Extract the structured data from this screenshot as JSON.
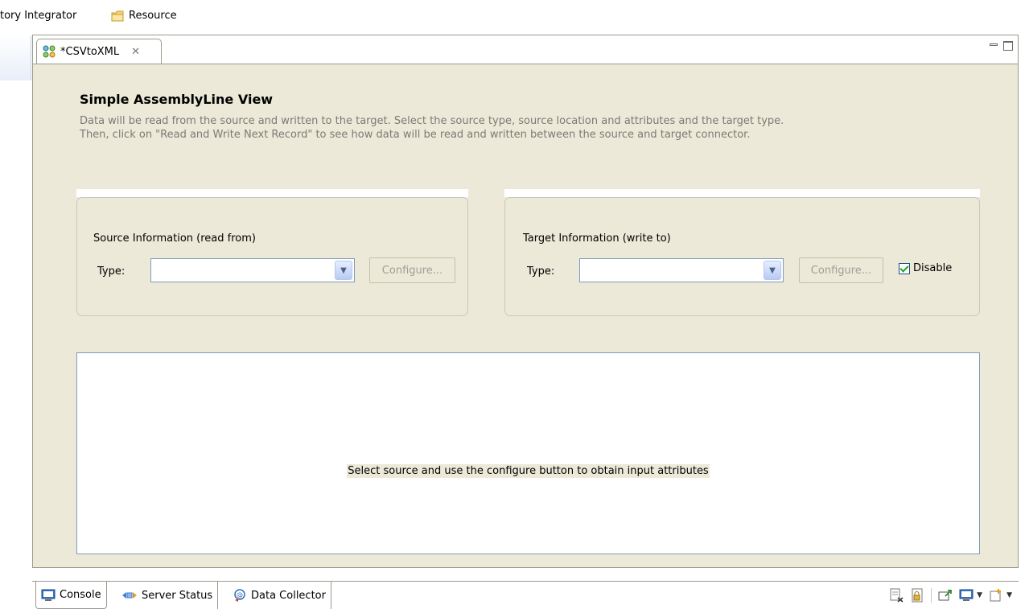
{
  "perspectives": {
    "integrator_label": "tory Integrator",
    "resource_label": "Resource"
  },
  "editor": {
    "tab_label": "*CSVtoXML",
    "tab_close_glyph": "✕",
    "title": "Simple AssemblyLine View",
    "description_line1": "Data will be read from the source and written to the target. Select the source type, source location and attributes and the target type.",
    "description_line2": "Then, click on \"Read and Write Next Record\" to see how data will be read and written between the source and target connector."
  },
  "source": {
    "group_label": "Source Information (read from)",
    "type_label": "Type:",
    "type_value": "",
    "configure_label": "Configure..."
  },
  "target": {
    "group_label": "Target Information (write to)",
    "type_label": "Type:",
    "type_value": "",
    "configure_label": "Configure...",
    "disable_label": "Disable",
    "disable_checked": true
  },
  "attributes": {
    "message": "Select source and use the configure button to obtain input attributes"
  },
  "bottom_tabs": [
    {
      "label": "Console",
      "icon": "console-icon"
    },
    {
      "label": "Server Status",
      "icon": "server-status-icon"
    },
    {
      "label": "Data Collector",
      "icon": "data-collector-icon"
    }
  ],
  "colors": {
    "panel_bg": "#ece9d8",
    "border_blue": "#7f9db9",
    "desc_text": "#7b7b75",
    "checkmark": "#21a121"
  }
}
